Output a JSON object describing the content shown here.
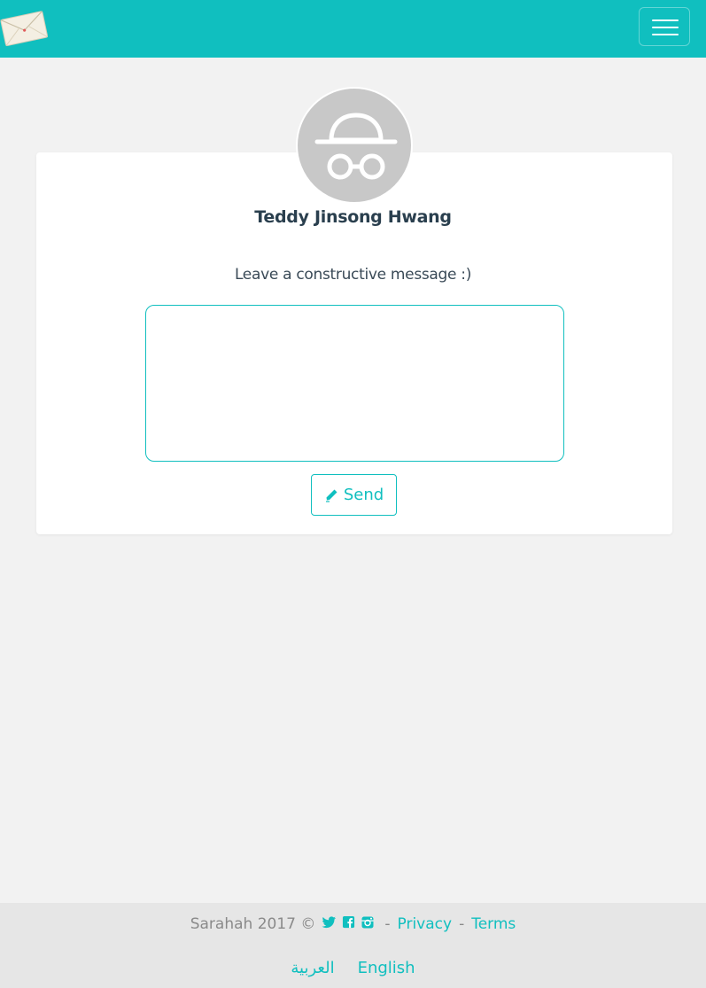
{
  "header": {
    "logo_icon": "envelope-icon",
    "menu_icon": "hamburger-menu-icon"
  },
  "profile": {
    "avatar_icon": "incognito-avatar-icon",
    "name": "Teddy Jinsong Hwang",
    "prompt": "Leave a constructive message :)"
  },
  "message": {
    "value": "",
    "placeholder": ""
  },
  "send_button": {
    "label": "Send",
    "icon": "pencil-icon"
  },
  "footer": {
    "copyright": "Sarahah 2017 ©",
    "social_icons": [
      "twitter-icon",
      "facebook-icon",
      "instagram-icon"
    ],
    "separator": "-",
    "privacy_link": "Privacy",
    "terms_link": "Terms",
    "languages": [
      "العربية",
      "English"
    ]
  },
  "colors": {
    "brand_teal": "#10bfbf",
    "background": "#f2f2f2",
    "footer_background": "#e6e6e6",
    "name_text": "#2a3f4e"
  }
}
